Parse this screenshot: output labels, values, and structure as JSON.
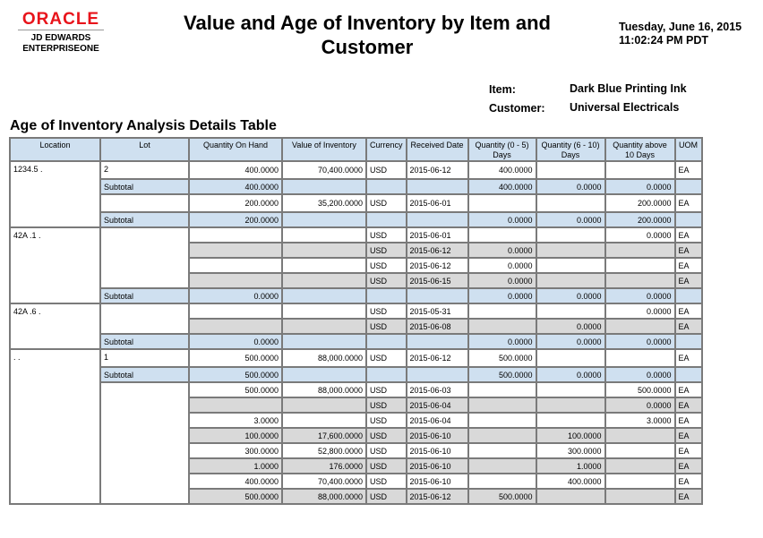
{
  "logo": {
    "brand": "ORACLE",
    "line1": "JD EDWARDS",
    "line2": "ENTERPRISEONE"
  },
  "title": "Value and Age of Inventory by Item and Customer",
  "date": "Tuesday, June 16, 2015",
  "time": "11:02:24 PM PDT",
  "item_label": "Item:",
  "item_value": "Dark Blue Printing Ink",
  "customer_label": "Customer:",
  "customer_value": "Universal Electricals",
  "section_title": "Age of Inventory Analysis Details Table",
  "columns": [
    "Location",
    "Lot",
    "Quantity On Hand",
    "Value of Inventory",
    "Currency",
    "Received Date",
    "Quantity (0 - 5) Days",
    "Quantity (6 - 10) Days",
    "Quantity above 10 Days",
    "UOM"
  ],
  "subtotal_label": "Subtotal",
  "groups": [
    {
      "location": "1234.5  .",
      "lots": [
        {
          "lot": "2",
          "rows": [
            [
              "400.0000",
              "70,400.0000",
              "USD",
              "2015-06-12",
              "400.0000",
              "",
              "",
              "EA"
            ]
          ],
          "subtotal": [
            "400.0000",
            "400.0000",
            "0.0000",
            "0.0000"
          ]
        },
        {
          "lot": "",
          "rows": [
            [
              "200.0000",
              "35,200.0000",
              "USD",
              "2015-06-01",
              "",
              "",
              "200.0000",
              "EA"
            ]
          ],
          "subtotal": [
            "200.0000",
            "0.0000",
            "0.0000",
            "200.0000"
          ]
        }
      ]
    },
    {
      "location": "42A .1  .",
      "lots": [
        {
          "lot": "",
          "rows": [
            [
              "",
              "",
              "USD",
              "2015-06-01",
              "",
              "",
              "0.0000",
              "EA"
            ],
            [
              "",
              "",
              "USD",
              "2015-06-12",
              "0.0000",
              "",
              "",
              "EA"
            ],
            [
              "",
              "",
              "USD",
              "2015-06-12",
              "0.0000",
              "",
              "",
              "EA"
            ],
            [
              "",
              "",
              "USD",
              "2015-06-15",
              "0.0000",
              "",
              "",
              "EA"
            ]
          ],
          "subtotal": [
            "0.0000",
            "0.0000",
            "0.0000",
            "0.0000"
          ]
        }
      ]
    },
    {
      "location": "42A .6  .",
      "lots": [
        {
          "lot": "",
          "rows": [
            [
              "",
              "",
              "USD",
              "2015-05-31",
              "",
              "",
              "0.0000",
              "EA"
            ],
            [
              "",
              "",
              "USD",
              "2015-06-08",
              "",
              "0.0000",
              "",
              "EA"
            ]
          ],
          "subtotal": [
            "0.0000",
            "0.0000",
            "0.0000",
            "0.0000"
          ]
        }
      ]
    },
    {
      "location": "  .  .",
      "lots": [
        {
          "lot": "1",
          "rows": [
            [
              "500.0000",
              "88,000.0000",
              "USD",
              "2015-06-12",
              "500.0000",
              "",
              "",
              "EA"
            ]
          ],
          "subtotal": [
            "500.0000",
            "500.0000",
            "0.0000",
            "0.0000"
          ]
        },
        {
          "lot": "",
          "rows": [
            [
              "500.0000",
              "88,000.0000",
              "USD",
              "2015-06-03",
              "",
              "",
              "500.0000",
              "EA"
            ],
            [
              "",
              "",
              "USD",
              "2015-06-04",
              "",
              "",
              "0.0000",
              "EA"
            ],
            [
              "3.0000",
              "",
              "USD",
              "2015-06-04",
              "",
              "",
              "3.0000",
              "EA"
            ],
            [
              "100.0000",
              "17,600.0000",
              "USD",
              "2015-06-10",
              "",
              "100.0000",
              "",
              "EA"
            ],
            [
              "300.0000",
              "52,800.0000",
              "USD",
              "2015-06-10",
              "",
              "300.0000",
              "",
              "EA"
            ],
            [
              "1.0000",
              "176.0000",
              "USD",
              "2015-06-10",
              "",
              "1.0000",
              "",
              "EA"
            ],
            [
              "400.0000",
              "70,400.0000",
              "USD",
              "2015-06-10",
              "",
              "400.0000",
              "",
              "EA"
            ],
            [
              "500.0000",
              "88,000.0000",
              "USD",
              "2015-06-12",
              "500.0000",
              "",
              "",
              "EA"
            ]
          ],
          "subtotal": null
        }
      ]
    }
  ]
}
